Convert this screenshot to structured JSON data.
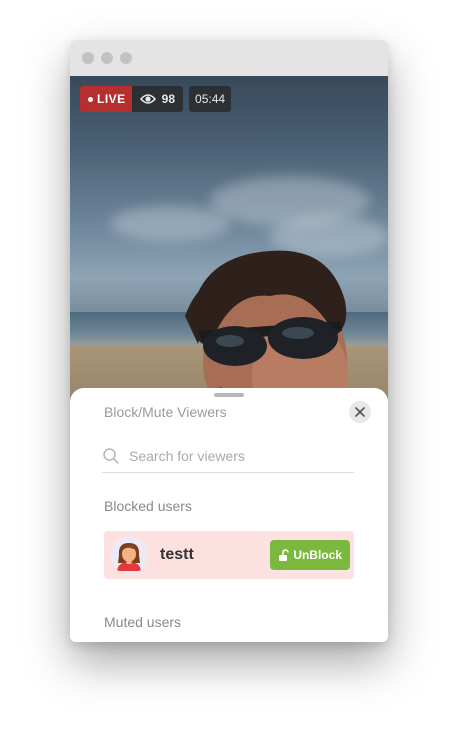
{
  "stream": {
    "live_label": "LIVE",
    "viewer_count": "98",
    "duration": "05:44",
    "icons": {
      "viewers": "eye-icon"
    }
  },
  "panel": {
    "title": "Block/Mute Viewers",
    "search": {
      "placeholder": "Search for viewers",
      "value": ""
    },
    "blocked_section": {
      "label": "Blocked users",
      "users": [
        {
          "name": "testt",
          "action_label": "UnBlock",
          "action_icon": "unlock-icon"
        }
      ]
    },
    "muted_section": {
      "label": "Muted users"
    }
  },
  "colors": {
    "live": "#b72e2e",
    "unblock": "#7ab83e",
    "blocked_row": "#fde0e0"
  }
}
